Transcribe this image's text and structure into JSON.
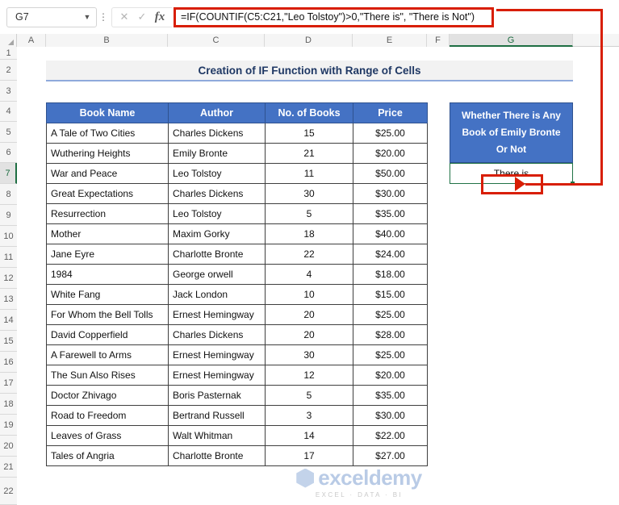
{
  "formula_bar": {
    "name_box_value": "G7",
    "chevron_icon": "chevron-down-icon",
    "kebab_icon": "more-options-icon",
    "cancel_icon": "✕",
    "enter_icon": "✓",
    "fx_icon": "fx",
    "formula": "=IF(COUNTIF(C5:C21,\"Leo Tolstoy\")>0,\"There is\", \"There is Not\")"
  },
  "grid": {
    "columns": [
      "A",
      "B",
      "C",
      "D",
      "E",
      "F",
      "G"
    ],
    "selected_column": "G",
    "rows": [
      "1",
      "2",
      "3",
      "4",
      "5",
      "6",
      "7",
      "8",
      "9",
      "10",
      "11",
      "12",
      "13",
      "14",
      "15",
      "16",
      "17",
      "18",
      "19",
      "20",
      "21",
      "22"
    ],
    "selected_row": "7"
  },
  "sheet": {
    "title": "Creation of IF Function with Range of Cells",
    "table": {
      "headers": [
        "Book Name",
        "Author",
        "No. of Books",
        "Price"
      ],
      "rows": [
        [
          "A Tale of Two Cities",
          "Charles Dickens",
          "15",
          "$25.00"
        ],
        [
          "Wuthering Heights",
          "Emily Bronte",
          "21",
          "$20.00"
        ],
        [
          "War and Peace",
          "Leo Tolstoy",
          "11",
          "$50.00"
        ],
        [
          "Great Expectations",
          "Charles Dickens",
          "30",
          "$30.00"
        ],
        [
          "Resurrection",
          "Leo Tolstoy",
          "5",
          "$35.00"
        ],
        [
          "Mother",
          "Maxim Gorky",
          "18",
          "$40.00"
        ],
        [
          "Jane Eyre",
          "Charlotte Bronte",
          "22",
          "$24.00"
        ],
        [
          "1984",
          "George orwell",
          "4",
          "$18.00"
        ],
        [
          "White Fang",
          "Jack London",
          "10",
          "$15.00"
        ],
        [
          "For Whom the Bell Tolls",
          "Ernest Hemingway",
          "20",
          "$25.00"
        ],
        [
          "David Copperfield",
          "Charles Dickens",
          "20",
          "$28.00"
        ],
        [
          "A Farewell to Arms",
          "Ernest Hemingway",
          "30",
          "$25.00"
        ],
        [
          "The Sun Also Rises",
          "Ernest Hemingway",
          "12",
          "$20.00"
        ],
        [
          "Doctor Zhivago",
          "Boris Pasternak",
          "5",
          "$35.00"
        ],
        [
          "Road to Freedom",
          "Bertrand Russell",
          "3",
          "$30.00"
        ],
        [
          "Leaves of Grass",
          "Walt Whitman",
          "14",
          "$22.00"
        ],
        [
          "Tales of Angria",
          "Charlotte Bronte",
          "17",
          "$27.00"
        ]
      ]
    },
    "result_column": {
      "header_lines": [
        "Whether There is Any",
        "Book of Emily Bronte",
        "Or Not"
      ],
      "value": "There is"
    }
  },
  "watermark": {
    "brand": "exceldemy",
    "tagline": "EXCEL · DATA · BI"
  },
  "colors": {
    "header_blue": "#4472c4",
    "title_text": "#1f3864",
    "annotation_red": "#d81e05",
    "selection_green": "#217346"
  }
}
